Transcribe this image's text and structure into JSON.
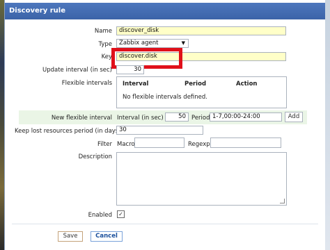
{
  "window": {
    "title": "Discovery rule"
  },
  "form": {
    "name_label": "Name",
    "name_value": "discover_disk",
    "type_label": "Type",
    "type_value": "Zabbix agent",
    "key_label": "Key",
    "key_value": "discover.disk",
    "update_interval_label": "Update interval (in sec)",
    "update_interval_value": "30",
    "flexible_intervals_label": "Flexible intervals",
    "flex_table": {
      "col_interval": "Interval",
      "col_period": "Period",
      "col_action": "Action",
      "empty_text": "No flexible intervals defined."
    },
    "new_flexible_label": "New flexible interval",
    "new_flex_interval_label": "Interval (in sec)",
    "new_flex_interval_value": "50",
    "new_flex_period_label": "Period",
    "new_flex_period_value": "1-7,00:00-24:00",
    "add_label": "Add",
    "keep_lost_label": "Keep lost resources period (in days)",
    "keep_lost_value": "30",
    "filter_label": "Filter",
    "macro_label": "Macro",
    "macro_value": "",
    "regexp_label": "Regexp",
    "regexp_value": "",
    "description_label": "Description",
    "description_value": "",
    "enabled_label": "Enabled",
    "enabled_checked": true
  },
  "buttons": {
    "save": "Save",
    "cancel": "Cancel"
  },
  "colors": {
    "title_bar": "#3b63a8",
    "highlight": "#e0101a",
    "required_field": "#ffffc8"
  }
}
